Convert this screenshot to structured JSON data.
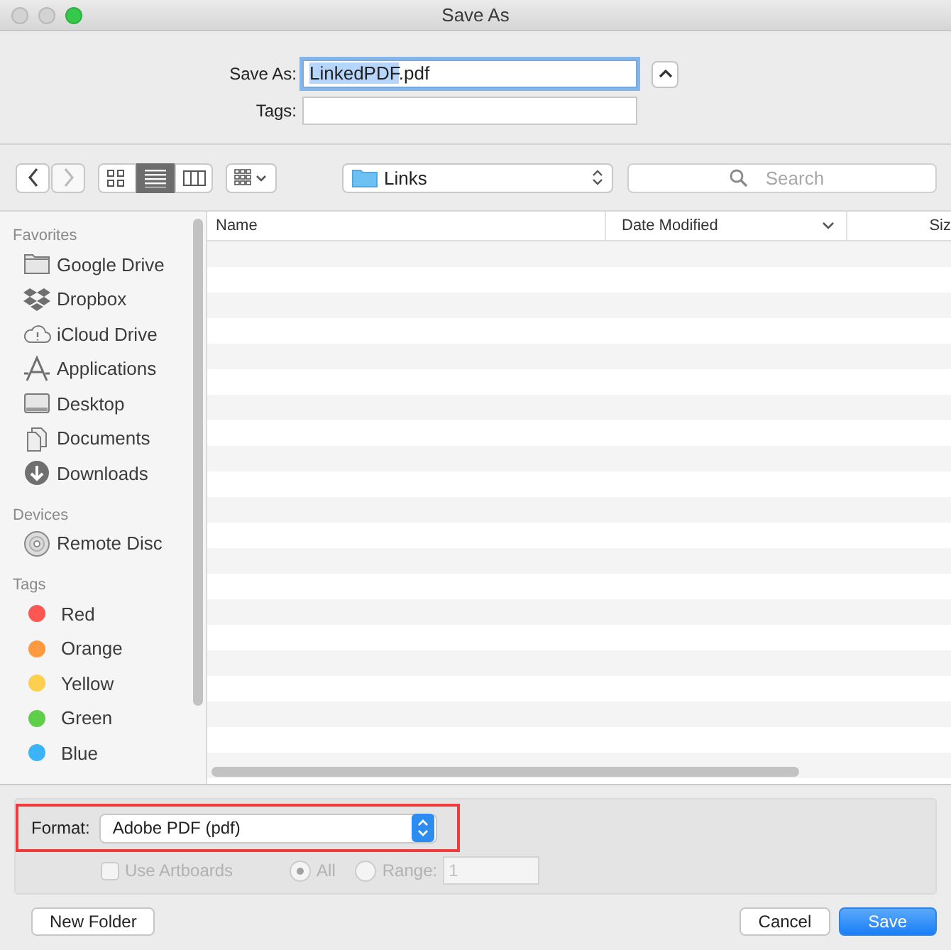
{
  "window": {
    "title": "Save As",
    "lights": [
      {
        "color": "#d3d3d3"
      },
      {
        "color": "#d3d3d3"
      },
      {
        "color": "#35c84a"
      }
    ]
  },
  "save_as": {
    "label": "Save As:",
    "value_parts": [
      {
        "text": "LinkedPDF",
        "selected": true
      },
      {
        "text": ".pdf",
        "selected": false
      }
    ]
  },
  "tags_field": {
    "label": "Tags:"
  },
  "toolbar": {
    "nav": [
      {
        "kind": "back",
        "disabled": false
      },
      {
        "kind": "forward",
        "disabled": true
      }
    ],
    "views": [
      {
        "kind": "icons",
        "selected": false
      },
      {
        "kind": "list",
        "selected": true
      },
      {
        "kind": "columns",
        "selected": false
      }
    ],
    "location": "Links",
    "search": {
      "placeholder": "Search"
    }
  },
  "sidebar": [
    {
      "heading": "Favorites",
      "items": [
        {
          "label": "Google Drive",
          "kind": "folder"
        },
        {
          "label": "Dropbox",
          "kind": "dropbox"
        },
        {
          "label": "iCloud Drive",
          "kind": "cloud"
        },
        {
          "label": "Applications",
          "kind": "apps"
        },
        {
          "label": "Desktop",
          "kind": "desktop"
        },
        {
          "label": "Documents",
          "kind": "documents"
        },
        {
          "label": "Downloads",
          "kind": "downloads"
        }
      ]
    },
    {
      "heading": "Devices",
      "items": [
        {
          "label": "Remote Disc",
          "kind": "disc"
        }
      ]
    },
    {
      "heading": "Tags",
      "items": [
        {
          "label": "Red",
          "kind": "tag",
          "color": "#fc5753"
        },
        {
          "label": "Orange",
          "kind": "tag",
          "color": "#fd9a3f"
        },
        {
          "label": "Yellow",
          "kind": "tag",
          "color": "#fdcf4f"
        },
        {
          "label": "Green",
          "kind": "tag",
          "color": "#5fce48"
        },
        {
          "label": "Blue",
          "kind": "tag",
          "color": "#3bb4f7"
        }
      ]
    }
  ],
  "columns": [
    {
      "label": "Name",
      "sorted": false
    },
    {
      "label": "Date Modified",
      "sorted": true
    },
    {
      "label": "Siz",
      "sorted": false
    }
  ],
  "format": {
    "label": "Format:",
    "value": "Adobe PDF (pdf)",
    "highlighted": true
  },
  "options": {
    "disabled": true,
    "artboards": {
      "label": "Use Artboards",
      "checked": false
    },
    "radios": [
      {
        "label": "All",
        "selected": true
      },
      {
        "label": "Range:",
        "selected": false
      }
    ],
    "range_value": "1"
  },
  "buttons": [
    {
      "label": "New Folder",
      "kind": "secondary"
    },
    {
      "label": "Cancel",
      "kind": "secondary"
    },
    {
      "label": "Save",
      "kind": "default"
    }
  ]
}
